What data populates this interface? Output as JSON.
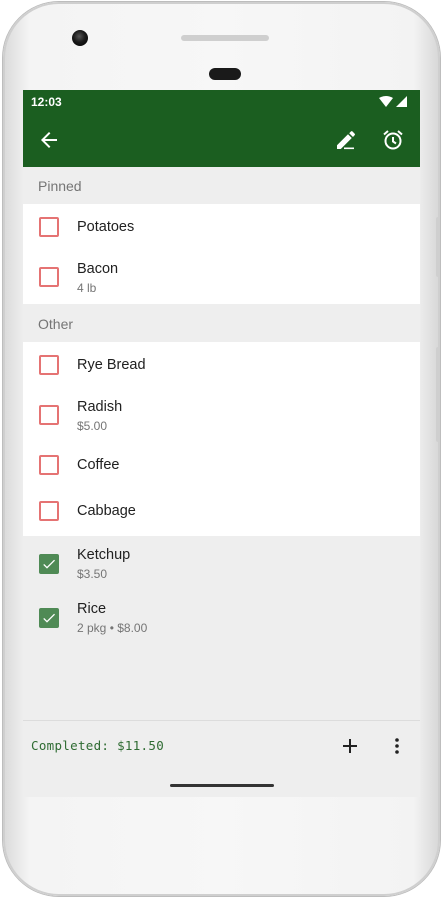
{
  "status": {
    "time": "12:03"
  },
  "toolbar": {
    "back_icon": "arrow-back-icon",
    "edit_icon": "edit-pencil-icon",
    "alarm_icon": "alarm-clock-icon",
    "color": "#1b5e20"
  },
  "sections": {
    "pinned": "Pinned",
    "other": "Other"
  },
  "pinned_items": [
    {
      "title": "Potatoes",
      "subtitle": ""
    },
    {
      "title": "Bacon",
      "subtitle": "4 lb"
    }
  ],
  "other_items": [
    {
      "title": "Rye Bread",
      "subtitle": ""
    },
    {
      "title": "Radish",
      "subtitle": "$5.00"
    },
    {
      "title": "Coffee",
      "subtitle": ""
    },
    {
      "title": "Cabbage",
      "subtitle": ""
    }
  ],
  "completed_items": [
    {
      "title": "Ketchup",
      "subtitle": "$3.50"
    },
    {
      "title": "Rice",
      "subtitle": "2 pkg • $8.00"
    }
  ],
  "footer": {
    "completed": "Completed: $11.50",
    "add_icon": "add-icon",
    "more_icon": "more-vert-icon"
  },
  "colors": {
    "unchecked_border": "#e57373",
    "checked_fill": "#4f8a55",
    "accent_text": "#2e6b32"
  }
}
